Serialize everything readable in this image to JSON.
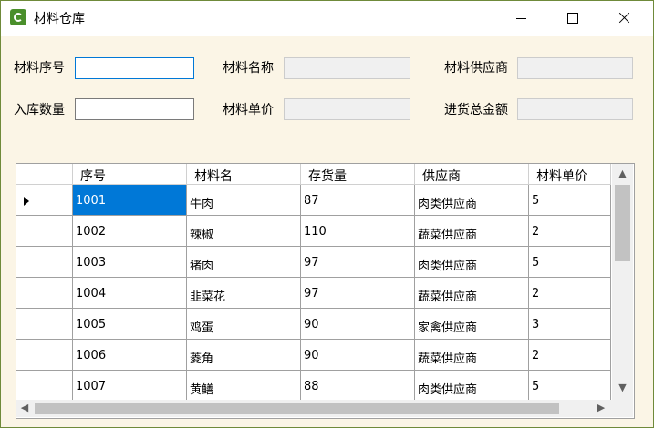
{
  "window": {
    "title": "材料仓库"
  },
  "form": {
    "serial_label": "材料序号",
    "serial_value": "",
    "name_label": "材料名称",
    "supplier_label": "材料供应商",
    "qty_label": "入库数量",
    "qty_value": "",
    "price_label": "材料单价",
    "total_label": "进货总金额"
  },
  "grid": {
    "columns": [
      "序号",
      "材料名",
      "存货量",
      "供应商",
      "材料单价"
    ],
    "rows": [
      [
        "1001",
        "牛肉",
        "87",
        "肉类供应商",
        "5"
      ],
      [
        "1002",
        "辣椒",
        "110",
        "蔬菜供应商",
        "2"
      ],
      [
        "1003",
        "猪肉",
        "97",
        "肉类供应商",
        "5"
      ],
      [
        "1004",
        "韭菜花",
        "97",
        "蔬菜供应商",
        "2"
      ],
      [
        "1005",
        "鸡蛋",
        "90",
        "家禽供应商",
        "3"
      ],
      [
        "1006",
        "菱角",
        "90",
        "蔬菜供应商",
        "2"
      ],
      [
        "1007",
        "黄鳝",
        "88",
        "肉类供应商",
        "5"
      ]
    ],
    "selected_row": 0
  },
  "icons": {
    "app": "app-logo-icon",
    "row_pointer": "current-row-arrow-icon",
    "scroll_up": "▲",
    "scroll_down": "▼",
    "scroll_left": "◀",
    "scroll_right": "▶"
  },
  "colors": {
    "accent": "#0078d7",
    "background": "#fbf5e6"
  }
}
